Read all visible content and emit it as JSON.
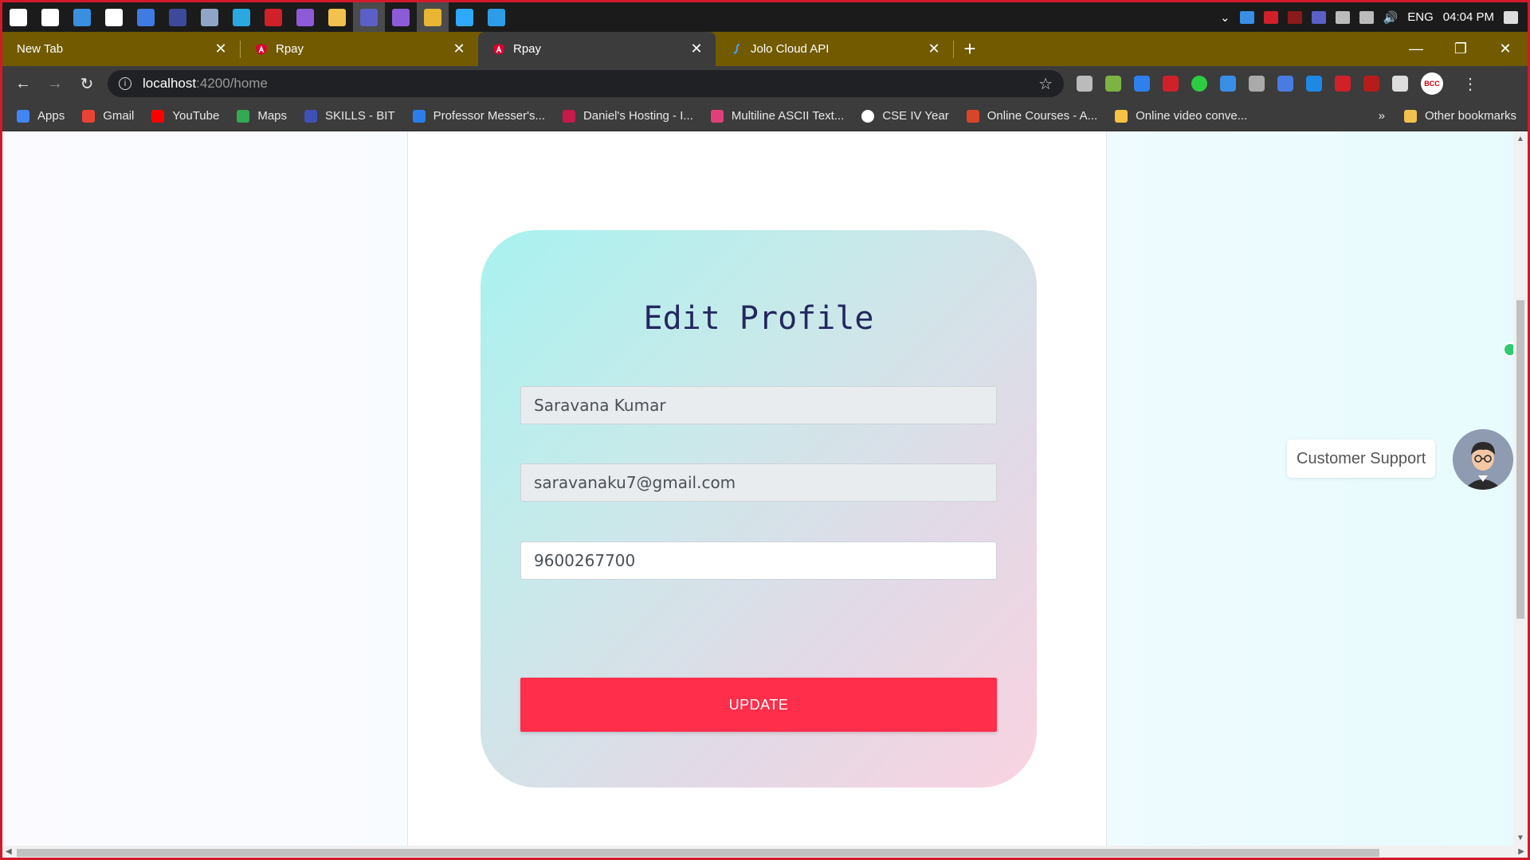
{
  "taskbar": {
    "apps": [
      {
        "icon": "start-icon",
        "color": "#ffffff"
      },
      {
        "icon": "task-view-icon",
        "color": "#ffffff"
      },
      {
        "icon": "store-icon",
        "color": "#3b8fe0"
      },
      {
        "icon": "notion-icon",
        "color": "#ffffff"
      },
      {
        "icon": "tablet-icon",
        "color": "#3f7be0"
      },
      {
        "icon": "dots-app-icon",
        "color": "#3d4a9a"
      },
      {
        "icon": "photos-icon",
        "color": "#8fa5c8"
      },
      {
        "icon": "edge-icon",
        "color": "#2ba8e0"
      },
      {
        "icon": "red-app-icon",
        "color": "#d0202a"
      },
      {
        "icon": "visual-studio-icon",
        "color": "#8e5bd8"
      },
      {
        "icon": "file-explorer-icon",
        "color": "#f2c14e"
      },
      {
        "icon": "teams-icon",
        "color": "#5b5fc7"
      },
      {
        "icon": "visual-studio-2-icon",
        "color": "#8e5bd8"
      },
      {
        "icon": "chrome-icon",
        "color": "#e8b634"
      },
      {
        "icon": "photoshop-icon",
        "color": "#2fa8ff"
      },
      {
        "icon": "vscode-icon",
        "color": "#2f9ce8"
      }
    ],
    "language": "ENG",
    "time": "04:04 PM"
  },
  "tabs": [
    {
      "title": "New Tab",
      "active": false,
      "favicon": "none"
    },
    {
      "title": "Rpay",
      "active": false,
      "favicon": "angular-icon"
    },
    {
      "title": "Rpay",
      "active": true,
      "favicon": "angular-icon"
    },
    {
      "title": "Jolo Cloud API",
      "active": false,
      "favicon": "jolo-icon"
    }
  ],
  "address": {
    "host": "localhost",
    "path": ":4200/home"
  },
  "bookmarks": [
    {
      "label": "Apps",
      "icon": "apps-grid-icon",
      "color": "#4285f4"
    },
    {
      "label": "Gmail",
      "icon": "gmail-icon",
      "color": "#ea4335"
    },
    {
      "label": "YouTube",
      "icon": "youtube-icon",
      "color": "#ff0000"
    },
    {
      "label": "Maps",
      "icon": "maps-icon",
      "color": "#34a853"
    },
    {
      "label": "SKILLS - BIT",
      "icon": "skills-icon",
      "color": "#3f51b5"
    },
    {
      "label": "Professor Messer's...",
      "icon": "messer-icon",
      "color": "#2b7de9"
    },
    {
      "label": "Daniel's Hosting - I...",
      "icon": "raspberry-icon",
      "color": "#c51a4a"
    },
    {
      "label": "Multiline ASCII Text...",
      "icon": "ascii-icon",
      "color": "#e0407a"
    },
    {
      "label": "CSE IV Year",
      "icon": "google-icon",
      "color": "#ffffff"
    },
    {
      "label": "Online Courses - A...",
      "icon": "courses-icon",
      "color": "#d9452b"
    },
    {
      "label": "Online video conve...",
      "icon": "video-converter-icon",
      "color": "#f5c242"
    }
  ],
  "bookmarks_overflow": "»",
  "other_bookmarks": "Other bookmarks",
  "profile": {
    "title": "Edit Profile"
  },
  "form": {
    "name": "Saravana Kumar",
    "email": "saravanaku7@gmail.com",
    "phone": "9600267700",
    "submit_label": "UPDATE"
  },
  "support": {
    "label": "Customer Support"
  },
  "colors": {
    "tabstrip": "#715a00",
    "update_button": "#ff2e4a",
    "title_text": "#23285e",
    "frame_border": "#d01a2a"
  }
}
